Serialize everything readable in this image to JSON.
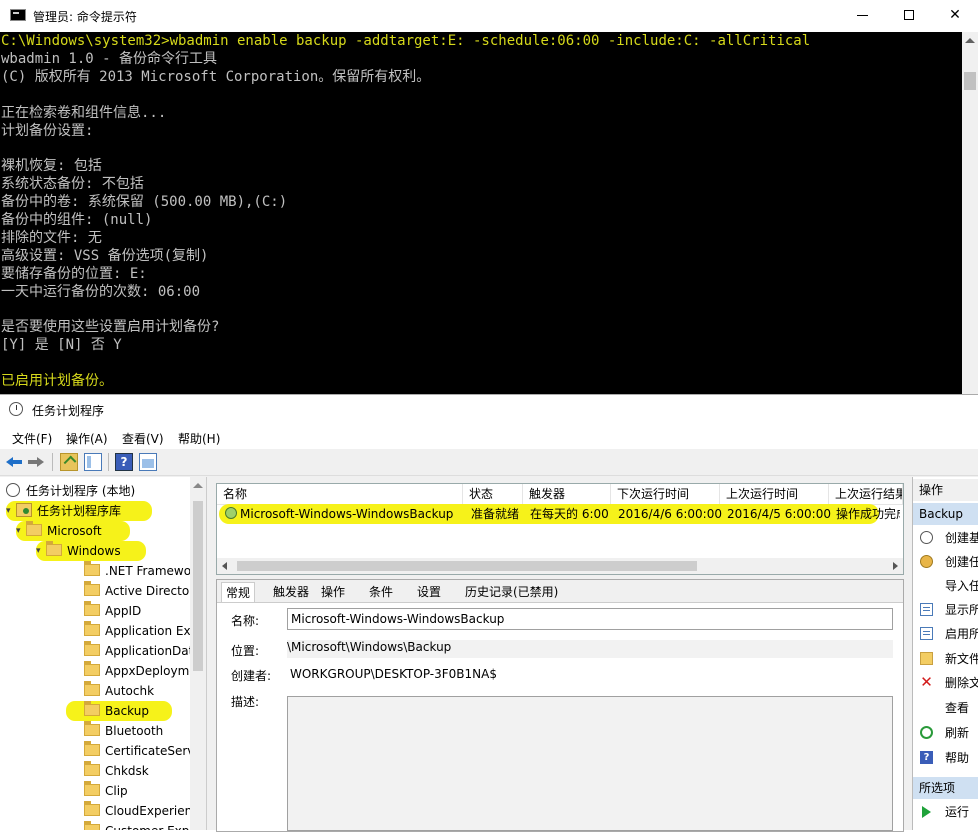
{
  "cmd": {
    "title": "管理员: 命令提示符",
    "lines": [
      {
        "text": "C:\\Windows\\system32>wbadmin enable backup -addtarget:E: -schedule:06:00 -include:C: -allCritical",
        "highlight": true
      },
      {
        "text": "wbadmin 1.0 - 备份命令行工具",
        "highlight": false
      },
      {
        "text": "(C) 版权所有 2013 Microsoft Corporation。保留所有权利。",
        "highlight": false
      },
      {
        "text": "",
        "highlight": false
      },
      {
        "text": "正在检索卷和组件信息...",
        "highlight": false
      },
      {
        "text": "计划备份设置:",
        "highlight": false
      },
      {
        "text": "",
        "highlight": false
      },
      {
        "text": "裸机恢复: 包括",
        "highlight": false
      },
      {
        "text": "系统状态备份: 不包括",
        "highlight": false
      },
      {
        "text": "备份中的卷: 系统保留 (500.00 MB),(C:)",
        "highlight": false
      },
      {
        "text": "备份中的组件: (null)",
        "highlight": false
      },
      {
        "text": "排除的文件: 无",
        "highlight": false
      },
      {
        "text": "高级设置: VSS 备份选项(复制)",
        "highlight": false
      },
      {
        "text": "要储存备份的位置: E:",
        "highlight": false
      },
      {
        "text": "一天中运行备份的次数: 06:00",
        "highlight": false
      },
      {
        "text": "",
        "highlight": false
      },
      {
        "text": "是否要使用这些设置启用计划备份?",
        "highlight": false
      },
      {
        "text": "[Y] 是 [N] 否 Y",
        "highlight": false
      },
      {
        "text": "",
        "highlight": false
      },
      {
        "text": "已启用计划备份。",
        "highlight": true
      }
    ],
    "highlight_color": "#d6d91b"
  },
  "scheduler": {
    "title": "任务计划程序",
    "menu": [
      "文件(F)",
      "操作(A)",
      "查看(V)",
      "帮助(H)"
    ],
    "tree": {
      "root": "任务计划程序 (本地)",
      "library": "任务计划程序库",
      "microsoft": "Microsoft",
      "windows": "Windows",
      "children": [
        ".NET Framewo",
        "Active Director",
        "AppID",
        "Application Exp",
        "ApplicationDat",
        "AppxDeployme",
        "Autochk",
        "Backup",
        "Bluetooth",
        "CertificateServi",
        "Chkdsk",
        "Clip",
        "CloudExperien",
        "Customer Expe"
      ]
    },
    "columns": [
      "名称",
      "状态",
      "触发器",
      "下次运行时间",
      "上次运行时间",
      "上次运行结果"
    ],
    "task": {
      "name": "Microsoft-Windows-WindowsBackup",
      "status": "准备就绪",
      "trigger": "在每天的 6:00",
      "next_run": "2016/4/6 6:00:00",
      "last_run": "2016/4/5 6:00:00",
      "last_result": "操作成功完成"
    },
    "tabs": [
      "常规",
      "触发器",
      "操作",
      "条件",
      "设置",
      "历史记录(已禁用)"
    ],
    "detail": {
      "name_label": "名称:",
      "name_value": "Microsoft-Windows-WindowsBackup",
      "location_label": "位置:",
      "location_value": "\\Microsoft\\Windows\\Backup",
      "author_label": "创建者:",
      "author_value": "WORKGROUP\\DESKTOP-3F0B1NA$",
      "desc_label": "描述:"
    },
    "actions": {
      "header": "操作",
      "group": "Backup",
      "items": [
        "创建基本任务...",
        "创建任务...",
        "导入任务...",
        "显示所有正在运行的任务",
        "启用所有任务历史记录",
        "新文件夹...",
        "删除文件夹",
        "查看",
        "刷新",
        "帮助"
      ],
      "selected_header": "所选项",
      "run": "运行"
    },
    "highlight_color": "#f6f21a"
  }
}
